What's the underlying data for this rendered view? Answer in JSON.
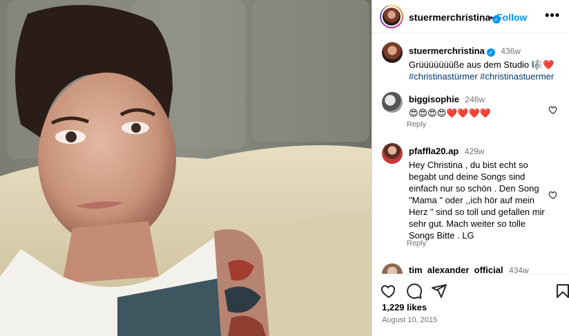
{
  "post": {
    "username": "stuermerchristina",
    "follow_label": "Follow",
    "dot": "•",
    "more_label": "•••",
    "likes": "1,229 likes",
    "date": "August 10, 2015"
  },
  "caption": {
    "username": "stuermerchristina",
    "time": "436w",
    "text": "Grüüüüüüüße aus dem Studio 🎼❤️",
    "hashtags": "#christinastürmer #christinastuermer"
  },
  "comments": [
    {
      "username": "biggisophie",
      "time": "246w",
      "text": "😍😍😍😍❤️❤️❤️❤️",
      "reply": "Reply"
    },
    {
      "username": "pfaffla20.ap",
      "time": "429w",
      "text": "Hey Christina , du bist echt so begabt und deine Songs sind einfach nur so schön . Den Song \"Mama \" oder ,,ich hör auf mein Herz \" sind so toll und gefallen mir sehr gut. Mach weiter so tolle Songs Bitte . LG",
      "reply": "Reply"
    },
    {
      "username": "tim_alexander_official",
      "time": "434w"
    }
  ],
  "icons": {
    "like": "heart-outline-icon",
    "comment": "speech-bubble-icon",
    "share": "paper-plane-icon",
    "save": "bookmark-icon"
  },
  "colors": {
    "link": "#0095f6",
    "hashtag": "#00376b",
    "muted": "#737373",
    "border": "#dbdbdb"
  }
}
